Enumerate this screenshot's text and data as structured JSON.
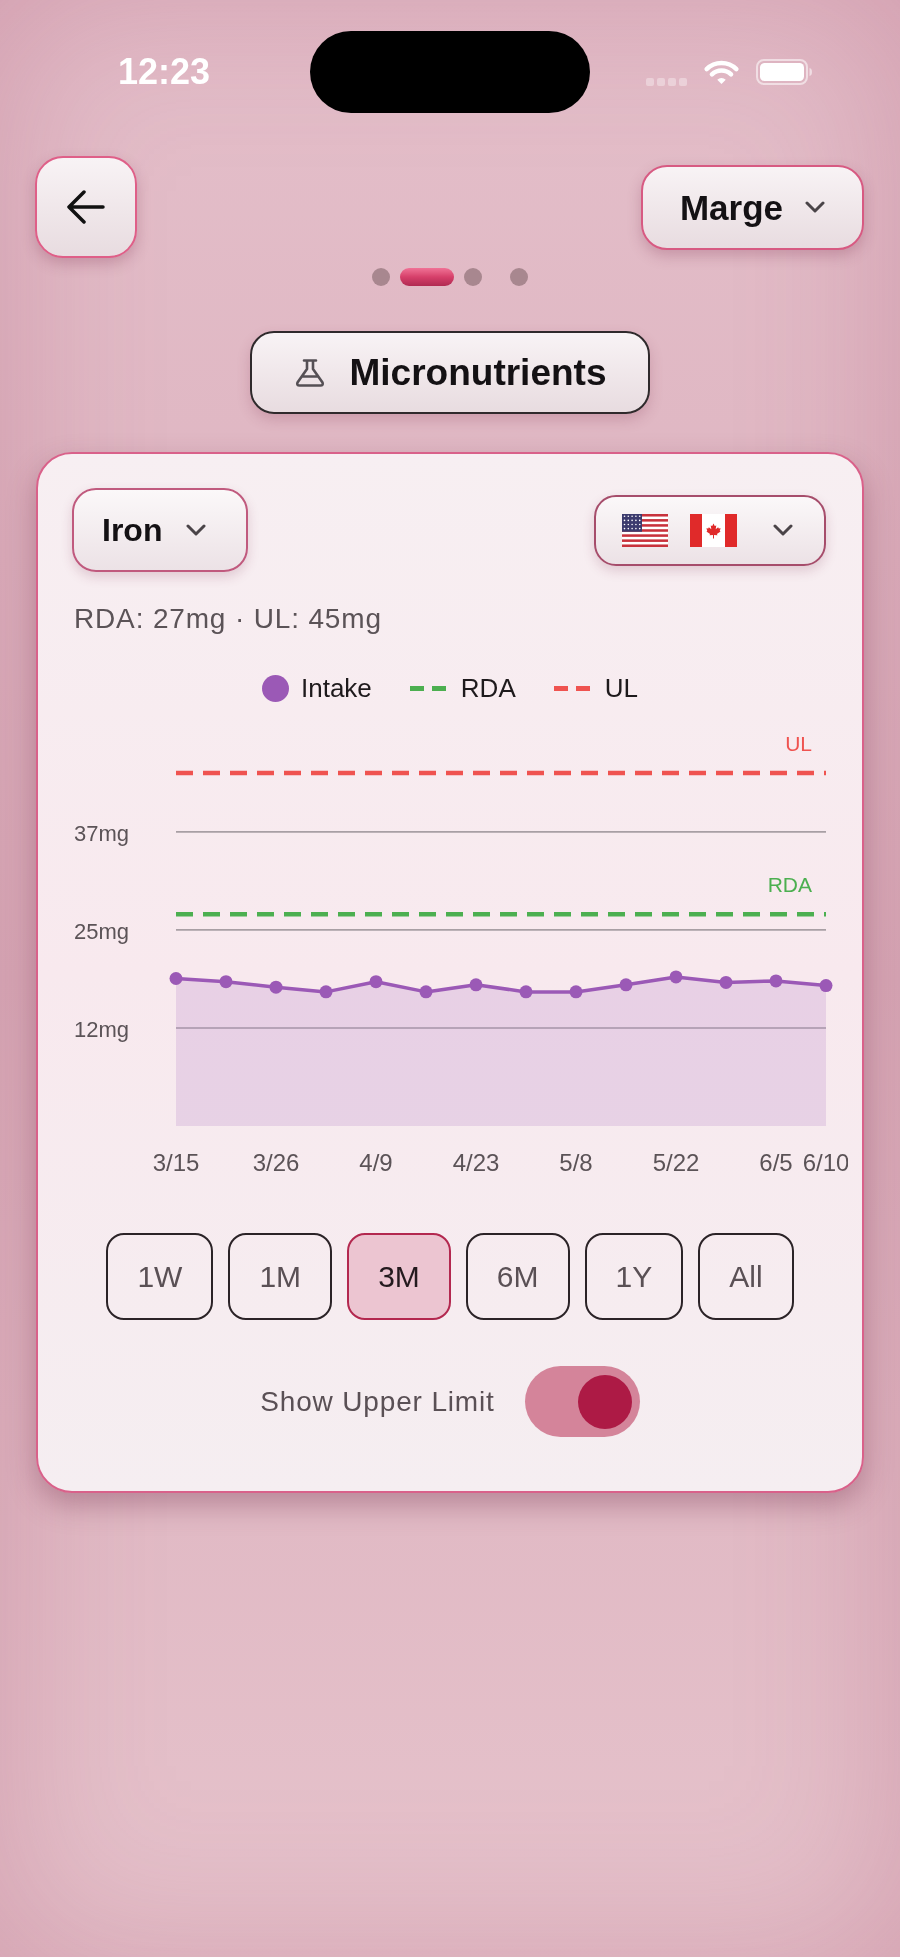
{
  "status_bar": {
    "time": "12:23"
  },
  "profile_menu": {
    "label": "Marge"
  },
  "page_indicator": [
    {
      "selected": false
    },
    {
      "selected": true
    },
    {
      "selected": false
    },
    {
      "selected": false
    }
  ],
  "section_button": {
    "label": "Micronutrients"
  },
  "card": {
    "nutrient_menu": {
      "label": "Iron"
    },
    "summary": "RDA: 27mg · UL: 45mg",
    "legend": [
      {
        "label": "RDA",
        "color": "#4caf50"
      },
      {
        "label": "UL",
        "color": "#ef5350"
      }
    ],
    "chart_data": {
      "type": "area",
      "categories": [
        "3/15",
        null,
        "3/26",
        null,
        "4/9",
        null,
        "4/23",
        null,
        "5/8",
        null,
        "5/22",
        null,
        "6/5",
        "6/10"
      ],
      "series": [
        {
          "name": "Intake",
          "color": "#9b59b6",
          "values": [
            18.8,
            18.4,
            17.7,
            17.1,
            18.4,
            17.1,
            18.0,
            17.1,
            17.1,
            18.0,
            19.0,
            18.3,
            18.5,
            17.9
          ]
        }
      ],
      "ylim": [
        0,
        45
      ],
      "yticks": [
        {
          "value": 12.5,
          "label": "12mg"
        },
        {
          "value": 25,
          "label": "25mg"
        },
        {
          "value": 37.5,
          "label": "37mg"
        }
      ],
      "grid": true,
      "ref_lines": [
        {
          "axis": "y",
          "value": 45,
          "label": "UL",
          "color": "#ef5350"
        },
        {
          "axis": "y",
          "value": 27,
          "label": "RDA",
          "color": "#4caf50"
        }
      ]
    },
    "ranges": [
      {
        "label": "1W",
        "selected": false
      },
      {
        "label": "1M",
        "selected": false
      },
      {
        "label": "3M",
        "selected": true
      },
      {
        "label": "6M",
        "selected": false
      },
      {
        "label": "1Y",
        "selected": false
      },
      {
        "label": "All",
        "selected": false
      }
    ],
    "upper_limit_toggle": {
      "label": "Show Upper Limit",
      "on": true
    }
  }
}
